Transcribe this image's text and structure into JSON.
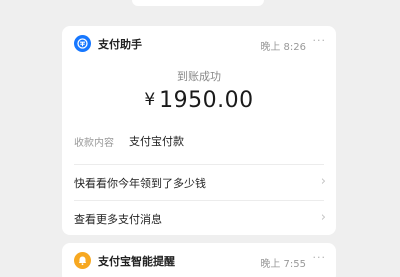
{
  "main_card": {
    "app_name": "支付助手",
    "time": "晚上 8:26",
    "more_glyph": "···",
    "status": "到账成功",
    "currency": "¥",
    "amount": "1950.00",
    "content_label": "收款内容",
    "content_value": "支付宝付款",
    "rows": [
      {
        "label": "快看看你今年领到了多少钱",
        "chevron": "›"
      },
      {
        "label": "查看更多支付消息",
        "chevron": "›"
      }
    ]
  },
  "next_card": {
    "app_name": "支付宝智能提醒",
    "time": "晚上 7:55",
    "more_glyph": "···"
  },
  "icons": {
    "main_app": "alipay-assistant-icon",
    "next_app": "smart-reminder-icon",
    "chevron": "chevron-right-icon",
    "more": "more-dots-icon"
  },
  "colors": {
    "background": "#efefef",
    "card": "#ffffff",
    "alipay_blue": "#1677ff",
    "reminder_orange": "#f7a821"
  }
}
